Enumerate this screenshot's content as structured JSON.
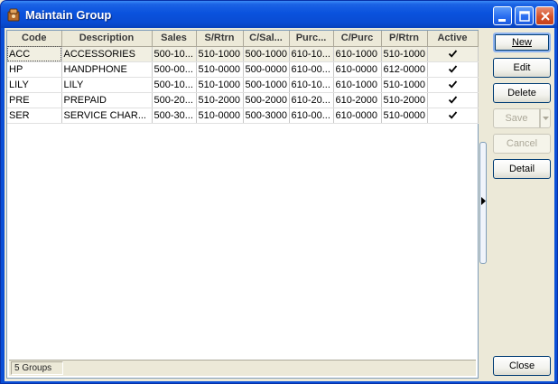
{
  "window": {
    "title": "Maintain Group"
  },
  "grid": {
    "columns": [
      "Code",
      "Description",
      "Sales",
      "S/Rtrn",
      "C/Sal...",
      "Purc...",
      "C/Purc",
      "P/Rtrn",
      "Active"
    ],
    "rows": [
      {
        "code": "ACC",
        "description": "ACCESSORIES",
        "sales": "500-10...",
        "srtrn": "510-1000",
        "csal": "500-1000",
        "purc": "610-10...",
        "cpurc": "610-1000",
        "prtrn": "510-1000",
        "active": true
      },
      {
        "code": "HP",
        "description": "HANDPHONE",
        "sales": "500-00...",
        "srtrn": "510-0000",
        "csal": "500-0000",
        "purc": "610-00...",
        "cpurc": "610-0000",
        "prtrn": "612-0000",
        "active": true
      },
      {
        "code": "LILY",
        "description": "LILY",
        "sales": "500-10...",
        "srtrn": "510-1000",
        "csal": "500-1000",
        "purc": "610-10...",
        "cpurc": "610-1000",
        "prtrn": "510-1000",
        "active": true
      },
      {
        "code": "PRE",
        "description": "PREPAID",
        "sales": "500-20...",
        "srtrn": "510-2000",
        "csal": "500-2000",
        "purc": "610-20...",
        "cpurc": "610-2000",
        "prtrn": "510-2000",
        "active": true
      },
      {
        "code": "SER",
        "description": "SERVICE CHAR...",
        "sales": "500-30...",
        "srtrn": "510-0000",
        "csal": "500-3000",
        "purc": "610-00...",
        "cpurc": "610-0000",
        "prtrn": "510-0000",
        "active": true
      }
    ]
  },
  "status": {
    "count_label": "5 Groups"
  },
  "buttons": {
    "new": "New",
    "edit": "Edit",
    "delete": "Delete",
    "save": "Save",
    "cancel": "Cancel",
    "detail": "Detail",
    "close": "Close"
  },
  "colors": {
    "title_blue": "#0a52dd",
    "selection": "#f1efe2",
    "face": "#ece9d8"
  },
  "icons": {
    "title": "group-app-icon",
    "check": "check-icon"
  }
}
